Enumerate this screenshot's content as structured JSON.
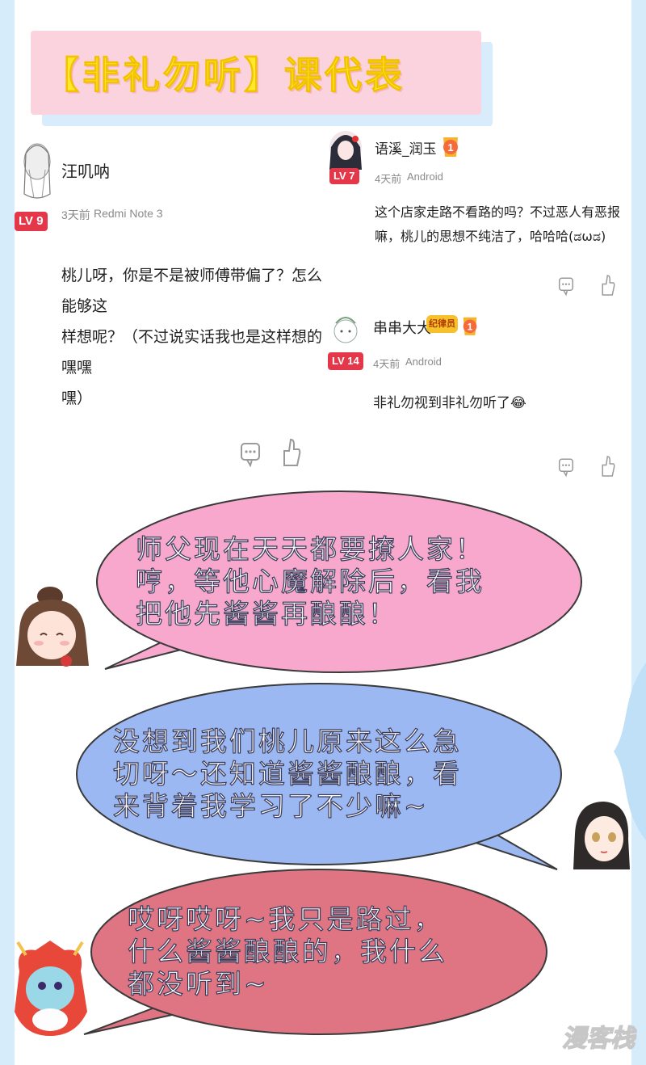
{
  "title": "【非礼勿听】课代表",
  "comments": [
    {
      "user": "汪叽呐",
      "level": "LV 9",
      "time": "3天前",
      "device": "Redmi Note 3",
      "text_lines": [
        "桃儿呀，你是不是被师傅带偏了？怎么能够这",
        "样想呢？（不过说实话我也是这样想的 嘿嘿",
        "嘿）"
      ]
    },
    {
      "user": "语溪_润玉",
      "level": "LV 7",
      "time": "4天前",
      "device": "Android",
      "text_lines": [
        "这个店家走路不看路的吗？不过恶人有恶报",
        "嘛，桃儿的思想不纯洁了，哈哈哈(ಡωಡ)"
      ]
    },
    {
      "user": "串串大大",
      "level": "LV 14",
      "badge": "纪律员",
      "time": "4天前",
      "device": "Android",
      "text_lines": [
        "非礼勿视到非礼勿听了😂"
      ]
    }
  ],
  "bubbles": [
    {
      "color": "#f7a8cc",
      "lines": [
        "师父现在天天都要撩人家！",
        "哼，等他心魔解除后，看我",
        "把他先酱酱再酿酿！"
      ]
    },
    {
      "color": "#9bb8f2",
      "lines": [
        "没想到我们桃儿原来这么急",
        "切呀～还知道酱酱酿酿，看",
        "来背着我学习了不少嘛~"
      ]
    },
    {
      "color": "#df7583",
      "lines": [
        "哎呀哎呀~我只是路过，",
        "什么酱酱酿酿的，我什么",
        "都没听到~"
      ]
    }
  ],
  "watermark": "漫客栈",
  "icons": [
    "comment-icon",
    "thumbs-up-icon",
    "medal-icon"
  ]
}
